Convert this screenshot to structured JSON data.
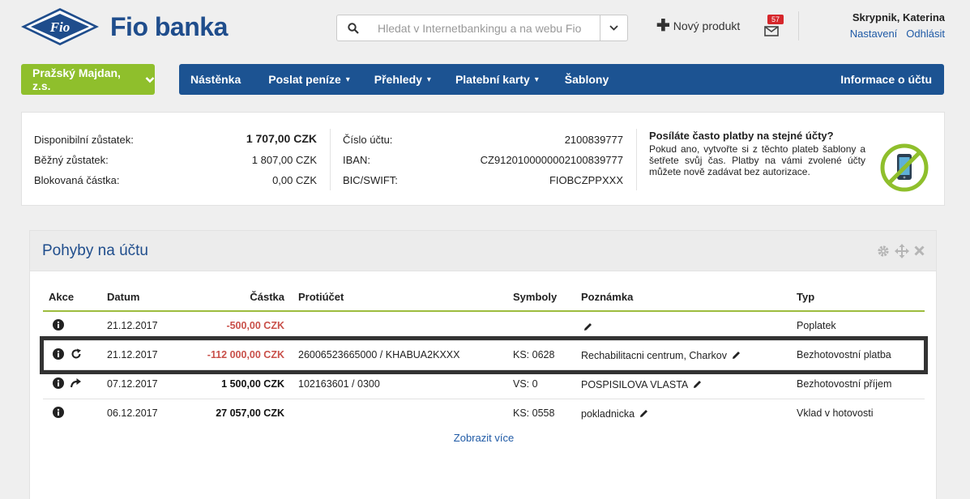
{
  "brand": {
    "name": "Fio banka",
    "logo_text": "Fio",
    "color": "#1f4d8c"
  },
  "search": {
    "placeholder": "Hledat v Internetbankingu a na webu Fio"
  },
  "header": {
    "new_product": "Nový produkt",
    "mail_count": "57",
    "user_name": "Skrypnik, Katerina",
    "settings_link": "Nastavení",
    "logout_link": "Odhlásit"
  },
  "account": {
    "name": "Pražský Majdan, z.s.",
    "color": "#8fbf2c"
  },
  "nav": {
    "items": [
      "Nástěnka",
      "Poslat peníze",
      "Přehledy",
      "Platební karty",
      "Šablony"
    ],
    "right": "Informace o účtu",
    "color": "#1c5392"
  },
  "summary": {
    "available_label": "Disponibilní zůstatek:",
    "available_value": "1 707,00 CZK",
    "current_label": "Běžný zůstatek:",
    "current_value": "1 807,00 CZK",
    "blocked_label": "Blokovaná částka:",
    "blocked_value": "0,00 CZK",
    "account_no_label": "Číslo účtu:",
    "account_no_value": "2100839777",
    "iban_label": "IBAN:",
    "iban_value": "CZ9120100000002100839777",
    "bic_label": "BIC/SWIFT:",
    "bic_value": "FIOBCZPPXXX",
    "promo_title": "Posíláte často platby na stejné účty?",
    "promo_text": "Pokud ano, vytvořte si z těchto plateb šablony a šetřete svůj čas. Platby na vámi zvolené účty můžete nově zadávat bez autorizace."
  },
  "transactions": {
    "title": "Pohyby na účtu",
    "columns": [
      "Akce",
      "Datum",
      "Částka",
      "Protiúčet",
      "Symboly",
      "Poznámka",
      "Typ"
    ],
    "rows": [
      {
        "date": "21.12.2017",
        "amount": "-500,00 CZK",
        "counter": "",
        "symbols": "",
        "note": "",
        "type": "Poplatek"
      },
      {
        "date": "21.12.2017",
        "amount": "-112 000,00 CZK",
        "counter": "26006523665000 / KHABUA2KXXX",
        "symbols": "KS: 0628",
        "note": "Rechabilitacni centrum, Charkov",
        "type": "Bezhotovostní platba"
      },
      {
        "date": "07.12.2017",
        "amount": "1 500,00 CZK",
        "counter": "102163601 / 0300",
        "symbols": "VS: 0",
        "note": "POSPISILOVA VLASTA",
        "type": "Bezhotovostní příjem"
      },
      {
        "date": "06.12.2017",
        "amount": "27 057,00 CZK",
        "counter": "",
        "symbols": "KS: 0558",
        "note": "pokladnicka",
        "type": "Vklad v hotovosti"
      }
    ],
    "show_more": "Zobrazit více"
  }
}
